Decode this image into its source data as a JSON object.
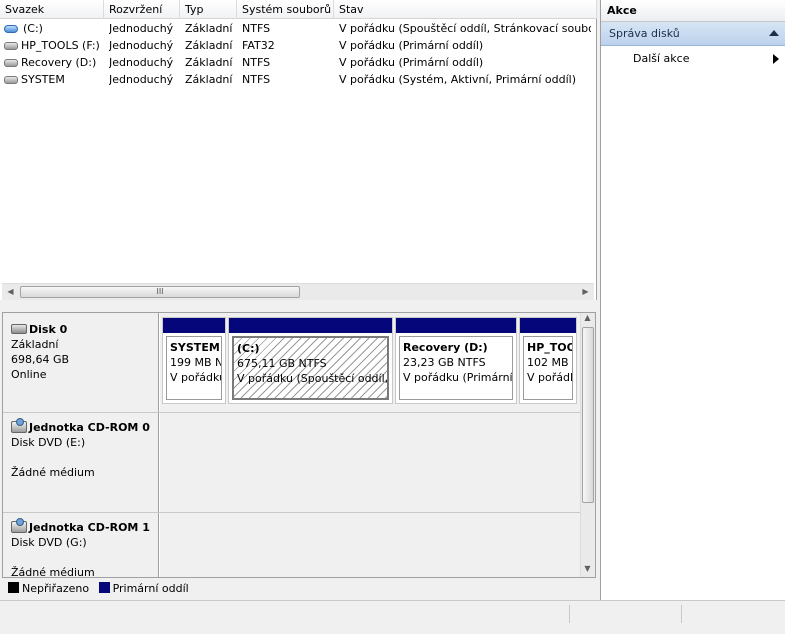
{
  "volume_list": {
    "columns": [
      "Svazek",
      "Rozvržení",
      "Typ",
      "Systém souborů",
      "Stav"
    ],
    "rows": [
      {
        "icon": "system-drive-icon",
        "name": "(C:)",
        "layout": "Jednoduchý",
        "type": "Základní",
        "fs": "NTFS",
        "status": "V pořádku (Spouštěcí oddíl, Stránkovací soubor,"
      },
      {
        "icon": "drive-icon",
        "name": "HP_TOOLS (F:)",
        "layout": "Jednoduchý",
        "type": "Základní",
        "fs": "FAT32",
        "status": "V pořádku (Primární oddíl)"
      },
      {
        "icon": "drive-icon",
        "name": "Recovery (D:)",
        "layout": "Jednoduchý",
        "type": "Základní",
        "fs": "NTFS",
        "status": "V pořádku (Primární oddíl)"
      },
      {
        "icon": "drive-icon",
        "name": "SYSTEM",
        "layout": "Jednoduchý",
        "type": "Základní",
        "fs": "NTFS",
        "status": "V pořádku (Systém, Aktivní, Primární oddíl)"
      }
    ],
    "scroll_grip": "III"
  },
  "disks": [
    {
      "title": "Disk 0",
      "line1": "Základní",
      "line2": "698,64 GB",
      "line3": "Online",
      "partitions": [
        {
          "name": "SYSTEM",
          "size": "199 MB N",
          "status": "V pořádku"
        },
        {
          "name": "(C:)",
          "size": "675,11 GB NTFS",
          "status": "V pořádku (Spouštěcí oddíl, S"
        },
        {
          "name": "Recovery  (D:)",
          "size": "23,23 GB NTFS",
          "status": "V pořádku (Primární"
        },
        {
          "name": "HP_TOO",
          "size": "102 MB",
          "status": "V pořádl"
        }
      ]
    },
    {
      "title": "Jednotka CD-ROM 0",
      "line1": "Disk DVD (E:)",
      "line2": "",
      "line3": "Žádné médium"
    },
    {
      "title": "Jednotka CD-ROM 1",
      "line1": "Disk DVD (G:)",
      "line2": "",
      "line3": "Žádné médium"
    }
  ],
  "legend": [
    {
      "label": "Nepřiřazeno",
      "color": "#000000"
    },
    {
      "label": "Primární oddíl",
      "color": "#06067b"
    }
  ],
  "actions": {
    "title": "Akce",
    "section": "Správa disků",
    "more": "Další akce"
  }
}
